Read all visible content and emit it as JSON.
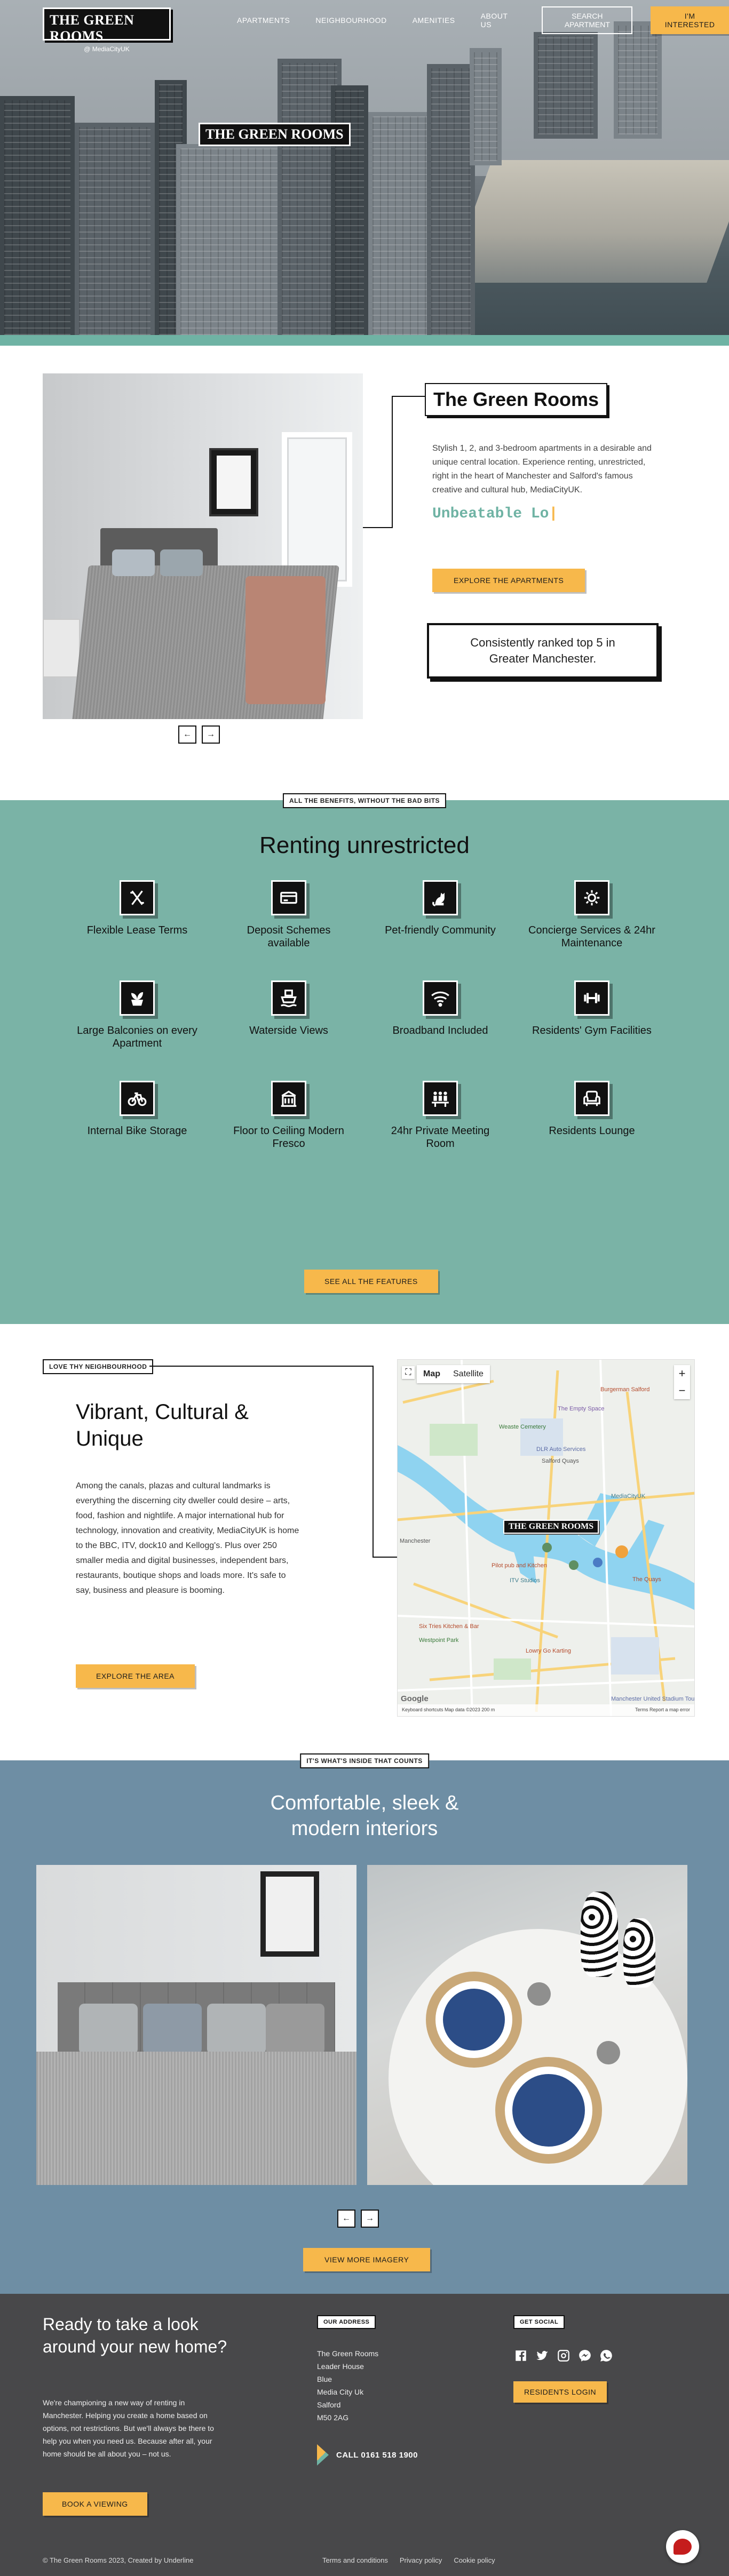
{
  "header": {
    "logo_main": "THE GREEN ROOMS",
    "logo_sub": "@ MediaCityUK",
    "building_sign": "THE GREEN ROOMS",
    "nav": [
      "APARTMENTS",
      "NEIGHBOURHOOD",
      "AMENITIES",
      "ABOUT US"
    ],
    "search_button": "SEARCH APARTMENT",
    "interested_button": "I'M INTERESTED"
  },
  "intro": {
    "title": "The Green Rooms",
    "text": "Stylish 1, 2, and 3-bedroom apartments in a desirable and unique central location. Experience renting, unrestricted, right in the heart of Manchester and Salford's famous creative and cultural hub, MediaCityUK.",
    "ticker": "Unbeatable Lo",
    "button": "EXPLORE THE APARTMENTS",
    "ranked": "Consistently ranked top 5 in Greater Manchester.",
    "prev": "←",
    "next": "→"
  },
  "features": {
    "tag": "ALL THE BENEFITS, WITHOUT THE BAD BITS",
    "title": "Renting unrestricted",
    "items": [
      {
        "label": "Flexible Lease Terms",
        "icon": "flexible-lease-icon"
      },
      {
        "label": "Deposit Schemes available",
        "icon": "credit-card-icon"
      },
      {
        "label": "Pet-friendly Community",
        "icon": "cat-icon"
      },
      {
        "label": "Concierge Services & 24hr Maintenance",
        "icon": "maintenance-gear-icon"
      },
      {
        "label": "Large Balconies on every Apartment",
        "icon": "plant-icon"
      },
      {
        "label": "Waterside Views",
        "icon": "boat-icon"
      },
      {
        "label": "Broadband Included",
        "icon": "wifi-icon"
      },
      {
        "label": "Residents' Gym Facilities",
        "icon": "dumbbell-icon"
      },
      {
        "label": "Internal Bike Storage",
        "icon": "bicycle-icon"
      },
      {
        "label": "Floor to Ceiling Modern Fresco",
        "icon": "building-icon"
      },
      {
        "label": "24hr Private Meeting Room",
        "icon": "meeting-icon"
      },
      {
        "label": "Residents Lounge",
        "icon": "armchair-icon"
      }
    ],
    "button": "SEE ALL THE FEATURES"
  },
  "neighbourhood": {
    "tag": "LOVE THY NEIGHBOURHOOD",
    "title": "Vibrant, Cultural & Unique",
    "text": "Among the canals, plazas and cultural landmarks is everything the discerning city dweller could desire – arts, food, fashion and nightlife. A major international hub for technology, innovation and creativity, MediaCityUK is home to the BBC, ITV, dock10 and Kellogg's. Plus over 250 smaller media and digital businesses, independent bars, restaurants, boutique shops and loads more. It's safe to say, business and pleasure is booming.",
    "button": "EXPLORE THE AREA",
    "map": {
      "map_tab": "Map",
      "satellite_tab": "Satellite",
      "marker": "THE GREEN ROOMS",
      "google": "Google",
      "footer_left": "Keyboard shortcuts   Map data ©2023   200 m",
      "footer_right": "Terms   Report a map error",
      "labels": [
        "The Empty Space",
        "Burgerman Salford",
        "Weaste Cemetery",
        "DLR Auto Services",
        "Salford Quays",
        "MediaCityUK",
        "ITV Studios",
        "Manchester",
        "Pilot pub and Kitchen",
        "Six Tries Kitchen & Bar",
        "Westpoint Park",
        "The Quays",
        "Manchester United Stadium Tour",
        "Lowry Go Karting"
      ]
    }
  },
  "interiors": {
    "tag": "IT'S WHAT'S INSIDE THAT COUNTS",
    "title_line1": "Comfortable, sleek &",
    "title_line2": "modern interiors",
    "prev": "←",
    "next": "→",
    "button": "VIEW MORE IMAGERY"
  },
  "footer": {
    "title": "Ready to take a look around your new home?",
    "lead": "We're championing a new way of renting in Manchester. Helping you create a home based on options, not restrictions. But we'll always be there to help you when you need us. Because after all, your home should be all about you – not us.",
    "book_button": "BOOK A VIEWING",
    "address_tag": "OUR ADDRESS",
    "address_lines": [
      "The Green Rooms",
      "Leader House",
      "Blue",
      "Media City Uk",
      "Salford",
      "M50 2AG"
    ],
    "call": "CALL 0161 518 1900",
    "social_tag": "GET SOCIAL",
    "login_button": "RESIDENTS LOGIN",
    "copyright": "© The Green Rooms 2023, Created by Underline",
    "links": [
      "Terms and conditions",
      "Privacy policy",
      "Cookie policy"
    ]
  },
  "colors": {
    "teal": "#7ab3a6",
    "amber": "#f7b84b",
    "slate_blue": "#6e8ea4",
    "footer_gray": "#48484a"
  }
}
